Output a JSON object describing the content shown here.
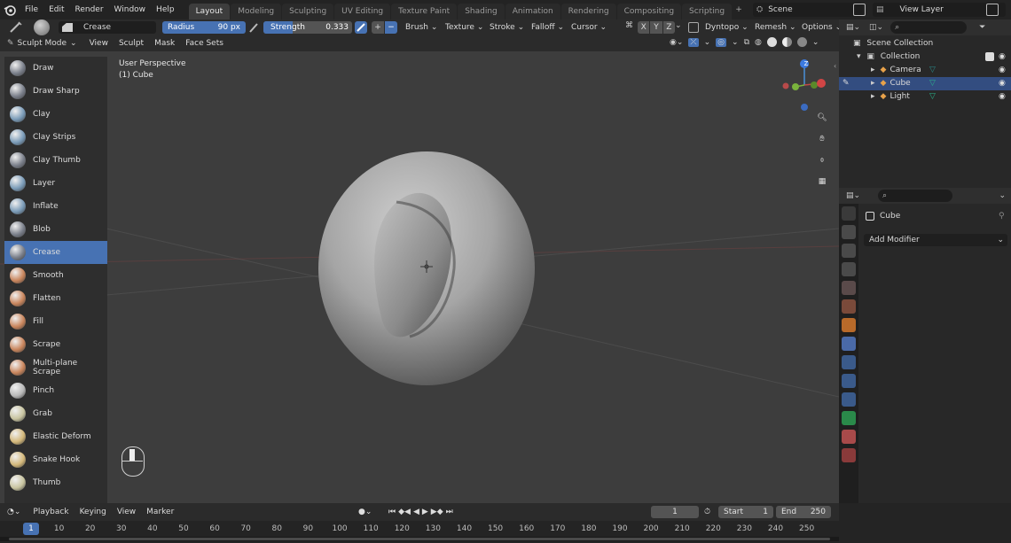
{
  "menu": [
    "File",
    "Edit",
    "Render",
    "Window",
    "Help"
  ],
  "workspaces": [
    {
      "label": "Layout",
      "active": true
    },
    {
      "label": "Modeling",
      "active": false
    },
    {
      "label": "Sculpting",
      "active": false
    },
    {
      "label": "UV Editing",
      "active": false
    },
    {
      "label": "Texture Paint",
      "active": false
    },
    {
      "label": "Shading",
      "active": false
    },
    {
      "label": "Animation",
      "active": false
    },
    {
      "label": "Rendering",
      "active": false
    },
    {
      "label": "Compositing",
      "active": false
    },
    {
      "label": "Scripting",
      "active": false
    }
  ],
  "scene": "Scene",
  "view_layer": "View Layer",
  "tool_header": {
    "brush": "Crease",
    "radius_label": "Radius",
    "radius_value": "90 px",
    "strength_label": "Strength",
    "strength_value": "0.333",
    "strength_fraction": 0.333,
    "add": "+",
    "sub": "−",
    "brush_menu": "Brush",
    "texture_menu": "Texture",
    "stroke_menu": "Stroke",
    "falloff_menu": "Falloff",
    "cursor_menu": "Cursor",
    "x": "X",
    "y": "Y",
    "z": "Z",
    "dyntopo": "Dyntopo",
    "remesh": "Remesh",
    "options": "Options"
  },
  "mode_header": {
    "mode": "Sculpt Mode",
    "items": [
      "View",
      "Sculpt",
      "Mask",
      "Face Sets"
    ]
  },
  "viewport": {
    "perspective": "User Perspective",
    "object": "(1) Cube",
    "axis_z": "Z"
  },
  "tools": [
    {
      "label": "Draw",
      "color": "#7a7f8a",
      "active": false
    },
    {
      "label": "Draw Sharp",
      "color": "#7a7f8a",
      "active": false
    },
    {
      "label": "Clay",
      "color": "#7a9bb8",
      "active": false
    },
    {
      "label": "Clay Strips",
      "color": "#7a9bb8",
      "active": false
    },
    {
      "label": "Clay Thumb",
      "color": "#7a7f8a",
      "active": false
    },
    {
      "label": "Layer",
      "color": "#7a9bb8",
      "active": false
    },
    {
      "label": "Inflate",
      "color": "#7a9bb8",
      "active": false
    },
    {
      "label": "Blob",
      "color": "#7a7f8a",
      "active": false
    },
    {
      "label": "Crease",
      "color": "#7a7f8a",
      "active": true
    },
    {
      "label": "Smooth",
      "color": "#c9855c",
      "active": false
    },
    {
      "label": "Flatten",
      "color": "#c9855c",
      "active": false
    },
    {
      "label": "Fill",
      "color": "#c9855c",
      "active": false
    },
    {
      "label": "Scrape",
      "color": "#c9855c",
      "active": false
    },
    {
      "label": "Multi-plane Scrape",
      "color": "#c9855c",
      "active": false
    },
    {
      "label": "Pinch",
      "color": "#b8b8b8",
      "active": false
    },
    {
      "label": "Grab",
      "color": "#c8c4a0",
      "active": false
    },
    {
      "label": "Elastic Deform",
      "color": "#d4b87a",
      "active": false
    },
    {
      "label": "Snake Hook",
      "color": "#d4b87a",
      "active": false
    },
    {
      "label": "Thumb",
      "color": "#c8c4a0",
      "active": false
    }
  ],
  "outliner": {
    "root": "Scene Collection",
    "collection": "Collection",
    "items": [
      {
        "label": "Camera",
        "selected": false
      },
      {
        "label": "Cube",
        "selected": true
      },
      {
        "label": "Light",
        "selected": false
      }
    ]
  },
  "properties": {
    "object": "Cube",
    "add_modifier": "Add Modifier"
  },
  "timeline": {
    "menus": [
      "Playback",
      "Keying",
      "View",
      "Marker"
    ],
    "current_frame": "1",
    "start_label": "Start",
    "start_value": "1",
    "end_label": "End",
    "end_value": "250",
    "ticks": [
      "1",
      "10",
      "20",
      "30",
      "40",
      "50",
      "60",
      "70",
      "80",
      "90",
      "100",
      "110",
      "120",
      "130",
      "140",
      "150",
      "160",
      "170",
      "180",
      "190",
      "200",
      "210",
      "220",
      "230",
      "240",
      "250"
    ]
  }
}
